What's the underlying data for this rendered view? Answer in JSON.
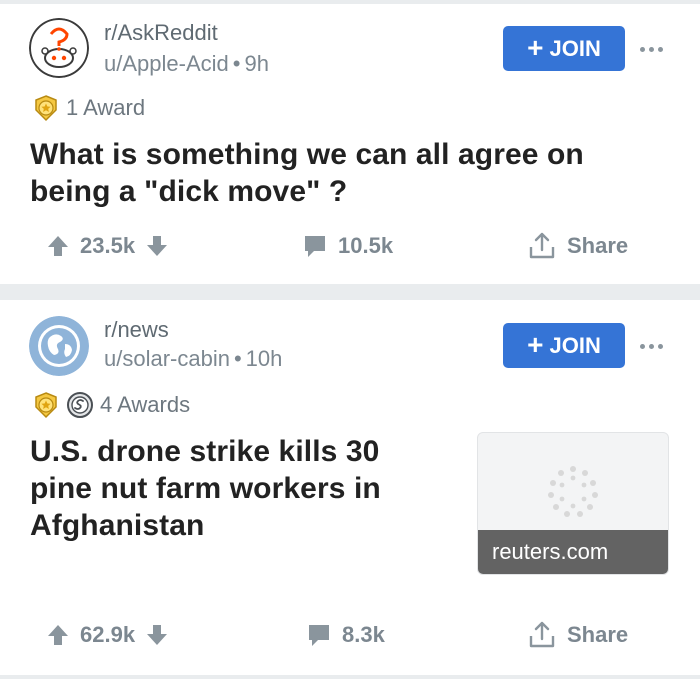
{
  "posts": [
    {
      "subreddit": "r/AskReddit",
      "author": "u/Apple-Acid",
      "age": "9h",
      "join_label": "JOIN",
      "awards_text": "1 Award",
      "title_lines": [
        "What is something we can all agree on",
        "being a \"dick move\" ?"
      ],
      "upvotes": "23.5k",
      "comments": "10.5k",
      "share_label": "Share",
      "avatar_icon": "askreddit-icon",
      "award_icons": [
        "gold-award-icon"
      ]
    },
    {
      "subreddit": "r/news",
      "author": "u/solar-cabin",
      "age": "10h",
      "join_label": "JOIN",
      "awards_text": "4 Awards",
      "title_lines": [
        "U.S. drone strike kills 30",
        "pine nut farm workers in",
        "Afghanistan"
      ],
      "link_domain": "reuters.com",
      "upvotes": "62.9k",
      "comments": "8.3k",
      "share_label": "Share",
      "avatar_icon": "globe-icon",
      "award_icons": [
        "gold-award-icon",
        "silver-award-icon"
      ]
    }
  ],
  "colors": {
    "background": "#e9ecee",
    "card": "#ffffff",
    "join_button": "#3574d6",
    "title_text": "#222222",
    "meta_text": "#7c8790",
    "icon_gray": "#8a959d"
  }
}
